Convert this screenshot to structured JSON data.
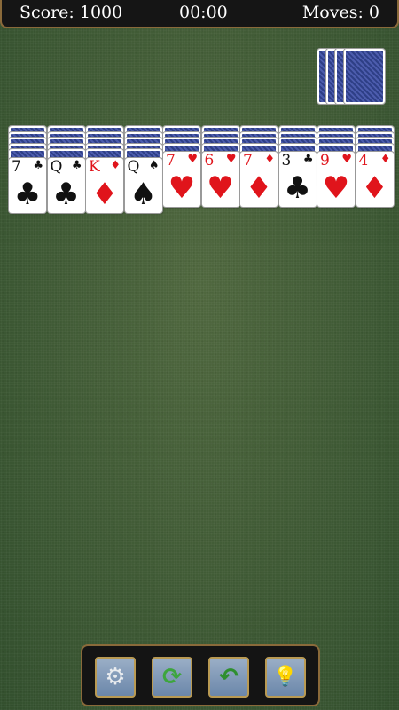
{
  "header": {
    "score_label": "Score:",
    "score_value": "1000",
    "timer": "00:00",
    "moves_label": "Moves:",
    "moves_value": "0"
  },
  "stock": {
    "decks_remaining": 4,
    "card_back": "blue-ornate-back"
  },
  "tableau": [
    {
      "face_down": 5,
      "top": {
        "rank": "7",
        "suit": "♣",
        "color": "black"
      }
    },
    {
      "face_down": 5,
      "top": {
        "rank": "Q",
        "suit": "♣",
        "color": "black"
      }
    },
    {
      "face_down": 5,
      "top": {
        "rank": "K",
        "suit": "♦",
        "color": "red"
      }
    },
    {
      "face_down": 5,
      "top": {
        "rank": "Q",
        "suit": "♠",
        "color": "black"
      }
    },
    {
      "face_down": 4,
      "top": {
        "rank": "7",
        "suit": "♥",
        "color": "red"
      }
    },
    {
      "face_down": 4,
      "top": {
        "rank": "6",
        "suit": "♥",
        "color": "red"
      }
    },
    {
      "face_down": 4,
      "top": {
        "rank": "7",
        "suit": "♦",
        "color": "red"
      }
    },
    {
      "face_down": 4,
      "top": {
        "rank": "3",
        "suit": "♣",
        "color": "black"
      }
    },
    {
      "face_down": 4,
      "top": {
        "rank": "9",
        "suit": "♥",
        "color": "red"
      }
    },
    {
      "face_down": 4,
      "top": {
        "rank": "4",
        "suit": "♦",
        "color": "red"
      }
    }
  ],
  "toolbar": [
    {
      "name": "settings-button",
      "icon": "gear-icon",
      "glyph": "⚙"
    },
    {
      "name": "restart-button",
      "icon": "refresh-icon",
      "glyph": "⟳"
    },
    {
      "name": "undo-button",
      "icon": "undo-arrow-icon",
      "glyph": "↶"
    },
    {
      "name": "hint-button",
      "icon": "lightbulb-icon",
      "glyph": "💡"
    }
  ],
  "colors": {
    "red_suit": "#e0141b",
    "black_suit": "#111111",
    "felt": "#44603a"
  }
}
